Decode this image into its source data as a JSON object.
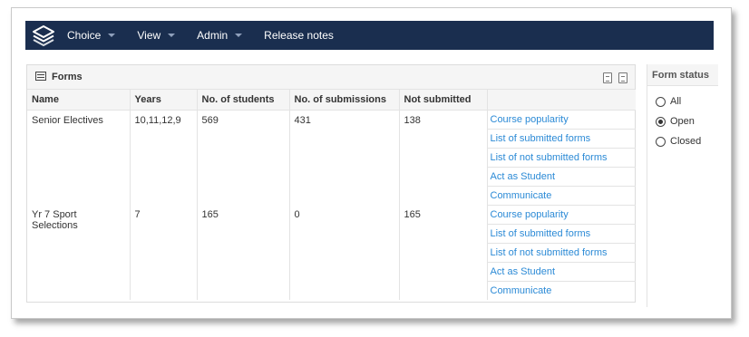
{
  "nav": {
    "logo_icon": "layers-icon",
    "items": [
      {
        "label": "Choice",
        "has_caret": true
      },
      {
        "label": "View",
        "has_caret": true
      },
      {
        "label": "Admin",
        "has_caret": true
      },
      {
        "label": "Release notes",
        "has_caret": false
      }
    ]
  },
  "forms_panel": {
    "title": "Forms",
    "title_icon": "list-icon",
    "export_icons": [
      "excel-export-icon",
      "pdf-export-icon"
    ],
    "columns": [
      "Name",
      "Years",
      "No. of students",
      "No. of submissions",
      "Not submitted",
      ""
    ],
    "rows": [
      {
        "name": "Senior Electives",
        "years": "10,11,12,9",
        "students": "569",
        "submissions": "431",
        "not_submitted": "138",
        "actions": [
          "Course popularity",
          "List of submitted forms",
          "List of not submitted forms",
          "Act as Student",
          "Communicate"
        ]
      },
      {
        "name": "Yr 7 Sport Selections",
        "years": "7",
        "students": "165",
        "submissions": "0",
        "not_submitted": "165",
        "actions": [
          "Course popularity",
          "List of submitted forms",
          "List of not submitted forms",
          "Act as Student",
          "Communicate"
        ]
      }
    ]
  },
  "status_panel": {
    "title": "Form status",
    "options": [
      {
        "label": "All",
        "selected": false
      },
      {
        "label": "Open",
        "selected": true
      },
      {
        "label": "Closed",
        "selected": false
      }
    ]
  },
  "colors": {
    "navbar": "#1a2e4f",
    "link": "#2b8ad6",
    "header_bg": "#f5f5f5"
  }
}
